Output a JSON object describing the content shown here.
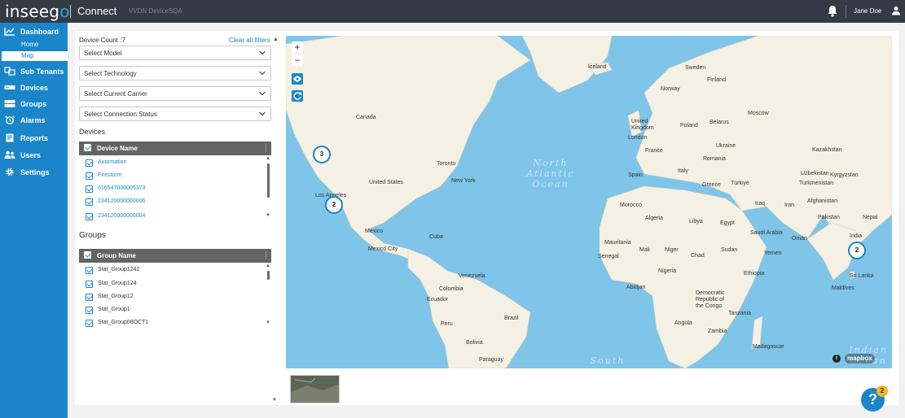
{
  "header": {
    "logo_part1": "inseeg",
    "logo_part2": "o",
    "product": "Connect",
    "tenant": "VVDN DeviceSQA",
    "user_name": "Jane Doe"
  },
  "sidebar": {
    "items": [
      {
        "label": "Dashboard",
        "icon": "chart-line-icon"
      },
      {
        "label": "Sub Tenants",
        "icon": "sub-tenants-icon"
      },
      {
        "label": "Devices",
        "icon": "router-icon"
      },
      {
        "label": "Groups",
        "icon": "groups-icon"
      },
      {
        "label": "Alarms",
        "icon": "alarm-icon"
      },
      {
        "label": "Reports",
        "icon": "reports-icon"
      },
      {
        "label": "Users",
        "icon": "users-icon"
      },
      {
        "label": "Settings",
        "icon": "gear-icon"
      }
    ],
    "dashboard_sub": [
      {
        "label": "Home"
      },
      {
        "label": "Map"
      }
    ]
  },
  "filters": {
    "device_count": "Device Count :7",
    "clear_all": "Clear all filters",
    "selects": [
      "Select Model",
      "Select Technology",
      "Select Current Carrier",
      "Select Connection Status"
    ]
  },
  "devices": {
    "section_title": "Devices",
    "header": "Device Name",
    "rows": [
      "Automation",
      "Firestorm",
      "016547000005373",
      "234120000000006",
      "234120000000004"
    ]
  },
  "groups": {
    "section_title": "Groups",
    "header": "Group Name",
    "rows": [
      "Stat_Group1242",
      "Stat_Group124",
      "Stat_Group12",
      "Stat_Group1",
      "Stat_Group08OCT1"
    ]
  },
  "map": {
    "zoom_in": "+",
    "zoom_out": "−",
    "clusters": [
      "3",
      "2",
      "2"
    ],
    "labels": [
      "Iceland",
      "Sweden",
      "Finland",
      "Norway",
      "Moscow",
      "United Kingdom",
      "Belarus",
      "London",
      "Poland",
      "Ukraine",
      "France",
      "Kazakhstan",
      "Spain",
      "Italy",
      "Romania",
      "Uzbekistan",
      "Kyrgyzstan",
      "Turkmenistan",
      "Greece",
      "Türkiye",
      "Afghanistan",
      "Iraq",
      "Iran",
      "Pakistan",
      "Nepal",
      "Morocco",
      "Algeria",
      "Libya",
      "Egypt",
      "Saudi Arabia",
      "Oman",
      "India",
      "Mauritania",
      "Mali",
      "Niger",
      "Sudan",
      "Chad",
      "Yemen",
      "Senegal",
      "Nigeria",
      "Ethiopia",
      "Abidjan",
      "Democratic Republic of the Congo",
      "Tanzania",
      "Angola",
      "Zambia",
      "Madagascar",
      "Sri Lanka",
      "Maldives",
      "Canada",
      "United States",
      "Toronto",
      "New York",
      "Los Angeles",
      "Mexico",
      "Cuba",
      "Mexico City",
      "Venezuela",
      "Colombia",
      "Ecuador",
      "Peru",
      "Brazil",
      "Bolivia",
      "Paraguay"
    ],
    "ocean_north": [
      "North",
      "Atlantic",
      "Ocean"
    ],
    "ocean_south": "South",
    "ocean_indian": [
      "Indian",
      "Ocean"
    ],
    "attribution": "mapbox",
    "info_icon": "i"
  },
  "help": {
    "label": "?",
    "badge": "2"
  },
  "colors": {
    "accent": "#1a86c9",
    "topbar": "#353b45",
    "water": "#7fc4e9",
    "land": "#f4f1e4"
  }
}
